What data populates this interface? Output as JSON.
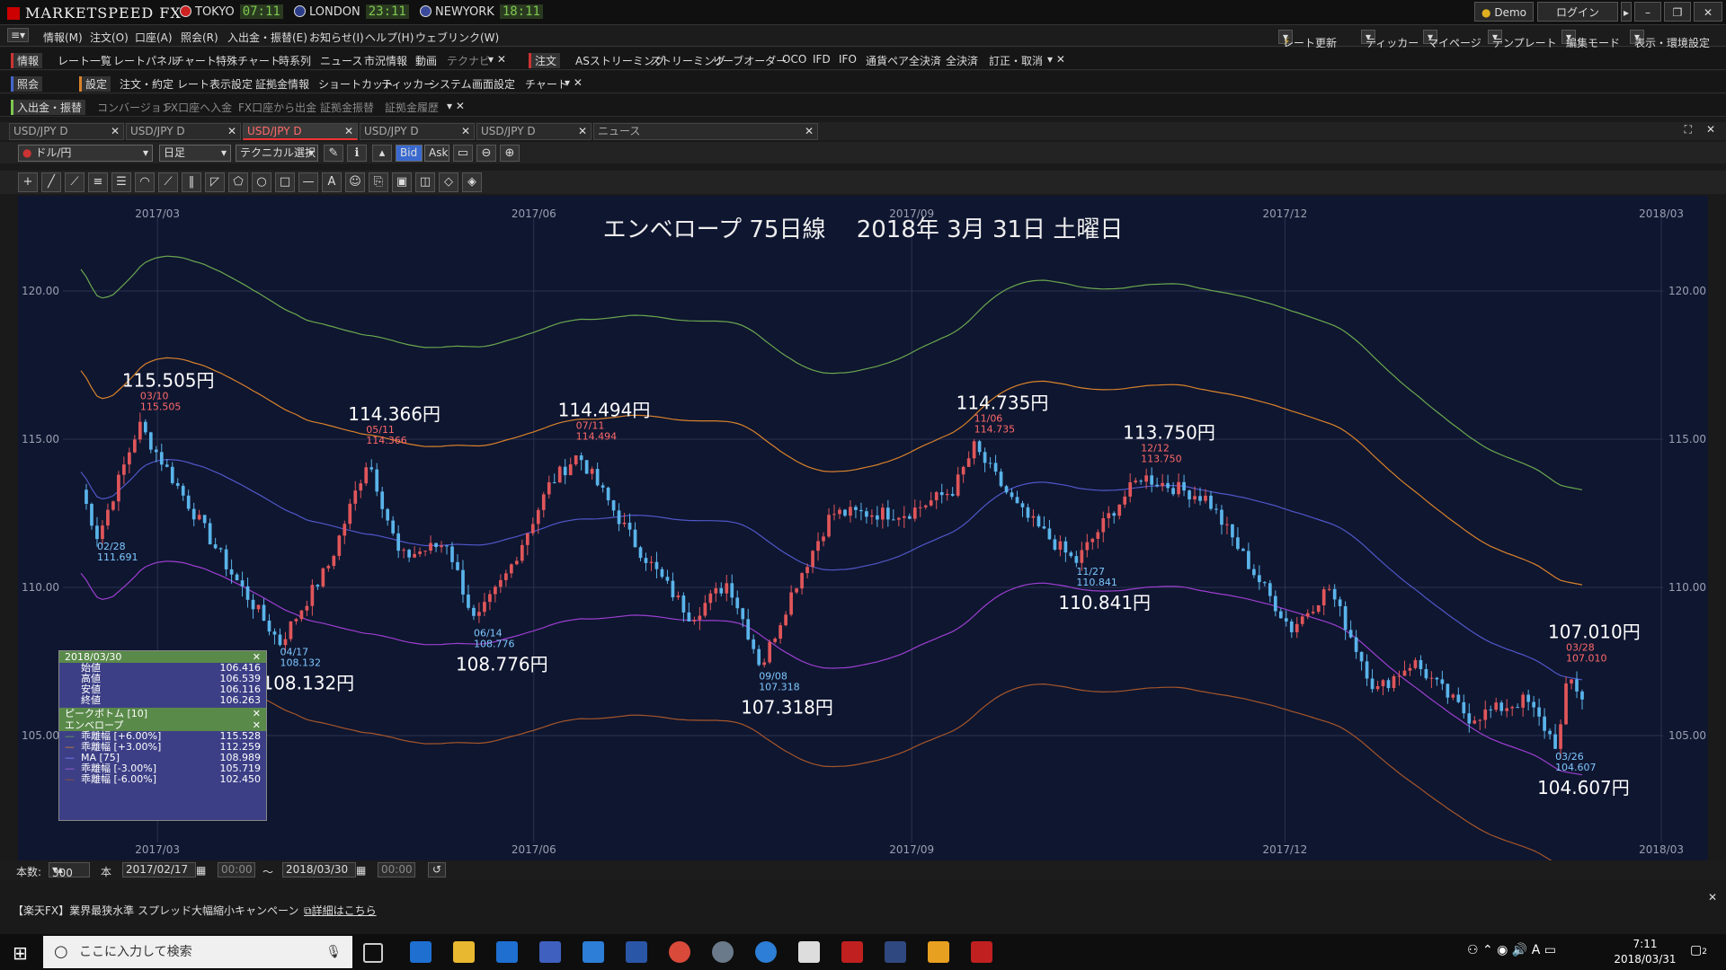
{
  "app": {
    "title": "MARKETSPEED FX",
    "clocks": [
      {
        "city": "TOKYO",
        "time": "07:11"
      },
      {
        "city": "LONDON",
        "time": "23:11"
      },
      {
        "city": "NEWYORK",
        "time": "18:11"
      }
    ],
    "demo_label": "Demo",
    "login_label": "ログイン"
  },
  "menu": [
    "情報(M)",
    "注文(O)",
    "口座(A)",
    "照会(R)",
    "入出金・振替(E)",
    "お知らせ(I)",
    "ヘルプ(H)",
    "ウェブリンク(W)"
  ],
  "right_menu": [
    "レート更新",
    "ティッカー",
    "マイページ",
    "テンプレート",
    "編集モード",
    "表示・環境設定"
  ],
  "toolbar1": {
    "group_a": "情報",
    "items_a": [
      "レート一覧",
      "レートパネル",
      "チャート",
      "特殊チャート",
      "時系列",
      "ニュース",
      "市況情報",
      "動画",
      "テクナビ"
    ],
    "group_b": "注文",
    "items_b": [
      "ASストリーミング",
      "ストリーミング",
      "リーブオーダー",
      "OCO",
      "IFD",
      "IFO",
      "通貨ペア全決済",
      "全決済",
      "訂正・取消"
    ]
  },
  "toolbar2": {
    "group_a": "照会",
    "group_b": "設定",
    "items_b": [
      "注文・約定",
      "レート表示設定",
      "証拠金情報",
      "ショートカット",
      "ティッカー",
      "システム",
      "画面設定",
      "チャート"
    ]
  },
  "toolbar3": {
    "group_a": "入出金・振替",
    "items_a": [
      "コンバージョン",
      "FX口座へ入金",
      "FX口座から出金",
      "証拠金振替",
      "証拠金履歴"
    ]
  },
  "tabs": [
    "USD/JPY D",
    "USD/JPY D",
    "USD/JPY D",
    "USD/JPY D",
    "USD/JPY D",
    "ニュース"
  ],
  "chart_toolbar": {
    "pair": "ドル/円",
    "period": "日足",
    "technical": "テクニカル選択",
    "bid": "Bid",
    "ask": "Ask"
  },
  "chart_data": {
    "type": "candlestick",
    "title": "エンベロープ 75日線　 2018年 3月 31日 土曜日",
    "x_ticks": [
      "2017/03",
      "2017/06",
      "2017/09",
      "2017/12",
      "2018/03"
    ],
    "y_ticks": [
      "105.00",
      "110.00",
      "115.00",
      "120.00"
    ],
    "ylim": [
      102.0,
      122.0
    ],
    "annotations": [
      {
        "date": "03/10",
        "price": "115.505",
        "big": "115.505円",
        "type": "high"
      },
      {
        "date": "02/28",
        "price": "111.691",
        "big": "",
        "type": "low"
      },
      {
        "date": "04/17",
        "price": "108.132",
        "big": "108.132円",
        "type": "low"
      },
      {
        "date": "05/11",
        "price": "114.366",
        "big": "114.366円",
        "type": "high"
      },
      {
        "date": "06/14",
        "price": "108.776",
        "big": "108.776円",
        "type": "low"
      },
      {
        "date": "07/11",
        "price": "114.494",
        "big": "114.494円",
        "type": "high"
      },
      {
        "date": "09/08",
        "price": "107.318",
        "big": "107.318円",
        "type": "low"
      },
      {
        "date": "11/06",
        "price": "114.735",
        "big": "114.735円",
        "type": "high"
      },
      {
        "date": "11/27",
        "price": "110.841",
        "big": "110.841円",
        "type": "low"
      },
      {
        "date": "12/12",
        "price": "113.750",
        "big": "113.750円",
        "type": "high"
      },
      {
        "date": "03/26",
        "price": "104.607",
        "big": "104.607円",
        "type": "low"
      },
      {
        "date": "03/28",
        "price": "107.010",
        "big": "107.010円",
        "type": "high"
      }
    ],
    "colors": {
      "up": "#e0565a",
      "down": "#5ab4ea",
      "ma": "#4f57c8",
      "env_p6": "#6aa84f",
      "env_p3": "#d9822b",
      "env_m3": "#9b3fd0",
      "env_m6": "#a5562a",
      "bg": "#0f1630"
    }
  },
  "infobox": {
    "date": "2018/03/30",
    "ohlc": [
      {
        "label": "始値",
        "value": "106.416"
      },
      {
        "label": "高値",
        "value": "106.539"
      },
      {
        "label": "安値",
        "value": "106.116"
      },
      {
        "label": "終値",
        "value": "106.263"
      }
    ],
    "peak_label": "ピークボトム [10]",
    "env_label": "エンベロープ",
    "env_rows": [
      {
        "label": "乖離幅 [+6.00%]",
        "value": "115.528"
      },
      {
        "label": "乖離幅 [+3.00%]",
        "value": "112.259"
      },
      {
        "label": "MA [75]",
        "value": "108.989"
      },
      {
        "label": "乖離幅 [-3.00%]",
        "value": "105.719"
      },
      {
        "label": "乖離幅 [-6.00%]",
        "value": "102.450"
      }
    ]
  },
  "bottom_bar": {
    "count_label": "本数:",
    "count": "300",
    "unit": "本",
    "from_date": "2017/02/17",
    "from_time": "00:00",
    "to_date": "2018/03/30",
    "to_time": "00:00",
    "tilde": "～"
  },
  "news": {
    "text": "【楽天FX】業界最狭水準 スプレッド大幅縮小キャンペーン",
    "link": "詳細はこちら"
  },
  "taskbar": {
    "search_placeholder": "ここに入力して検索",
    "time": "7:11",
    "date": "2018/03/31",
    "notif": "2"
  }
}
